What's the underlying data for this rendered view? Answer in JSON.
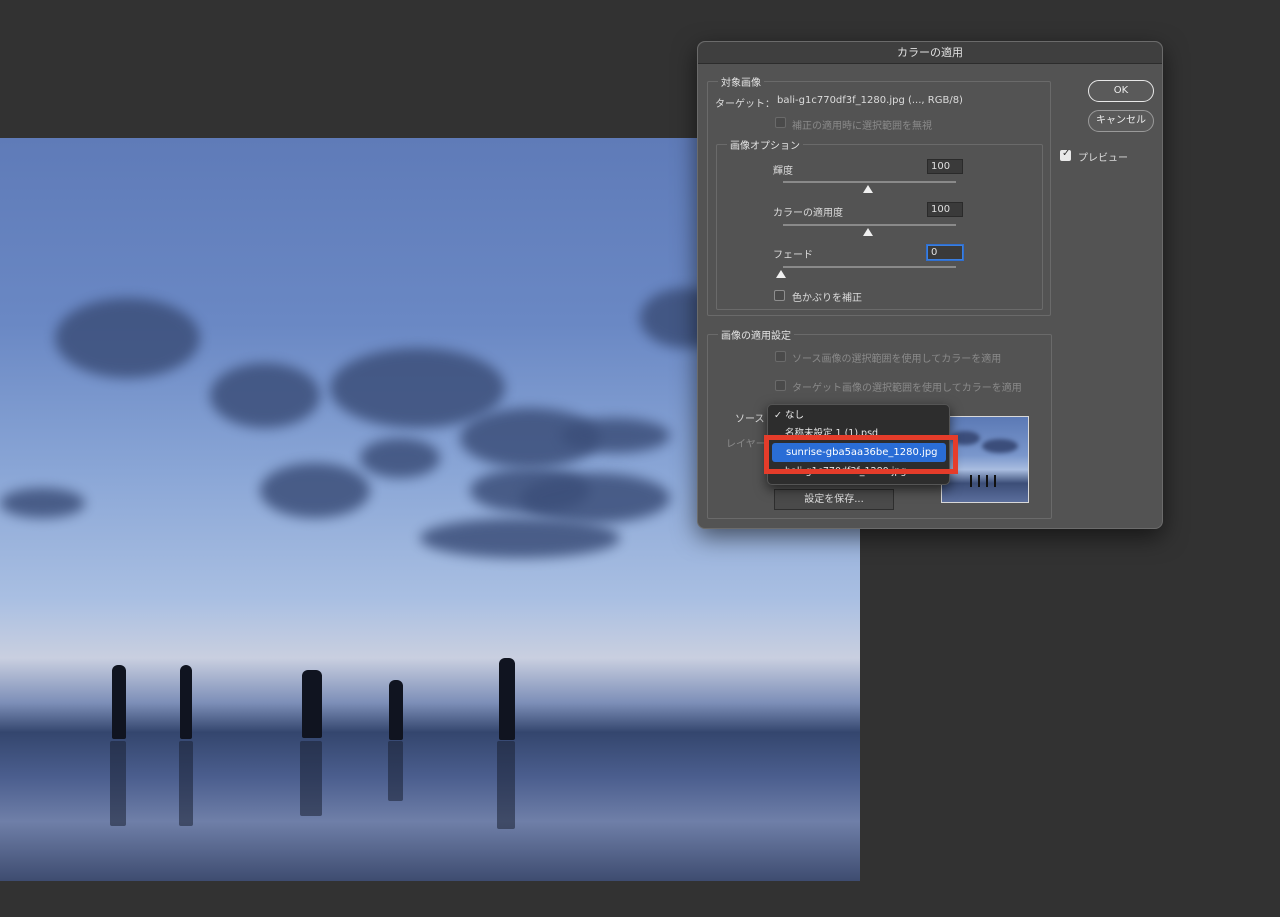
{
  "dialog": {
    "title": "カラーの適用",
    "target_group": {
      "label": "対象画像",
      "target_label": "ターゲット：",
      "target_value": "bali-g1c770df3f_1280.jpg (..., RGB/8)",
      "ignore_selection": "補正の適用時に選択範囲を無視"
    },
    "image_options": {
      "label": "画像オプション",
      "luminance": {
        "label": "輝度",
        "value": "100",
        "slider_fraction": 0.5
      },
      "color_intensity": {
        "label": "カラーの適用度",
        "value": "100",
        "slider_fraction": 0.5
      },
      "fade": {
        "label": "フェード",
        "value": "0",
        "slider_fraction": 0.0
      },
      "neutralize": "色かぶりを補正"
    },
    "statistics": {
      "label": "画像の適用設定",
      "use_source_selection": "ソース画像の選択範囲を使用してカラーを適用",
      "use_target_selection": "ターゲット画像の選択範囲を使用してカラーを適用",
      "source_label": "ソース",
      "layer_label": "レイヤー",
      "save_button": "設定を保存..."
    },
    "ok": "OK",
    "cancel": "キャンセル",
    "preview": "プレビュー"
  },
  "source_menu": {
    "items": [
      "なし",
      "名称未設定 1 (1).psd",
      "sunrise-gba5aa36be_1280.jpg",
      "bali-g1c770df3f_1280.jpg"
    ],
    "checked_index": 0,
    "highlighted_index": 2,
    "check_mark": "✓"
  },
  "colors": {
    "highlight": "#2a6dd6",
    "callout": "#e53c2a"
  }
}
